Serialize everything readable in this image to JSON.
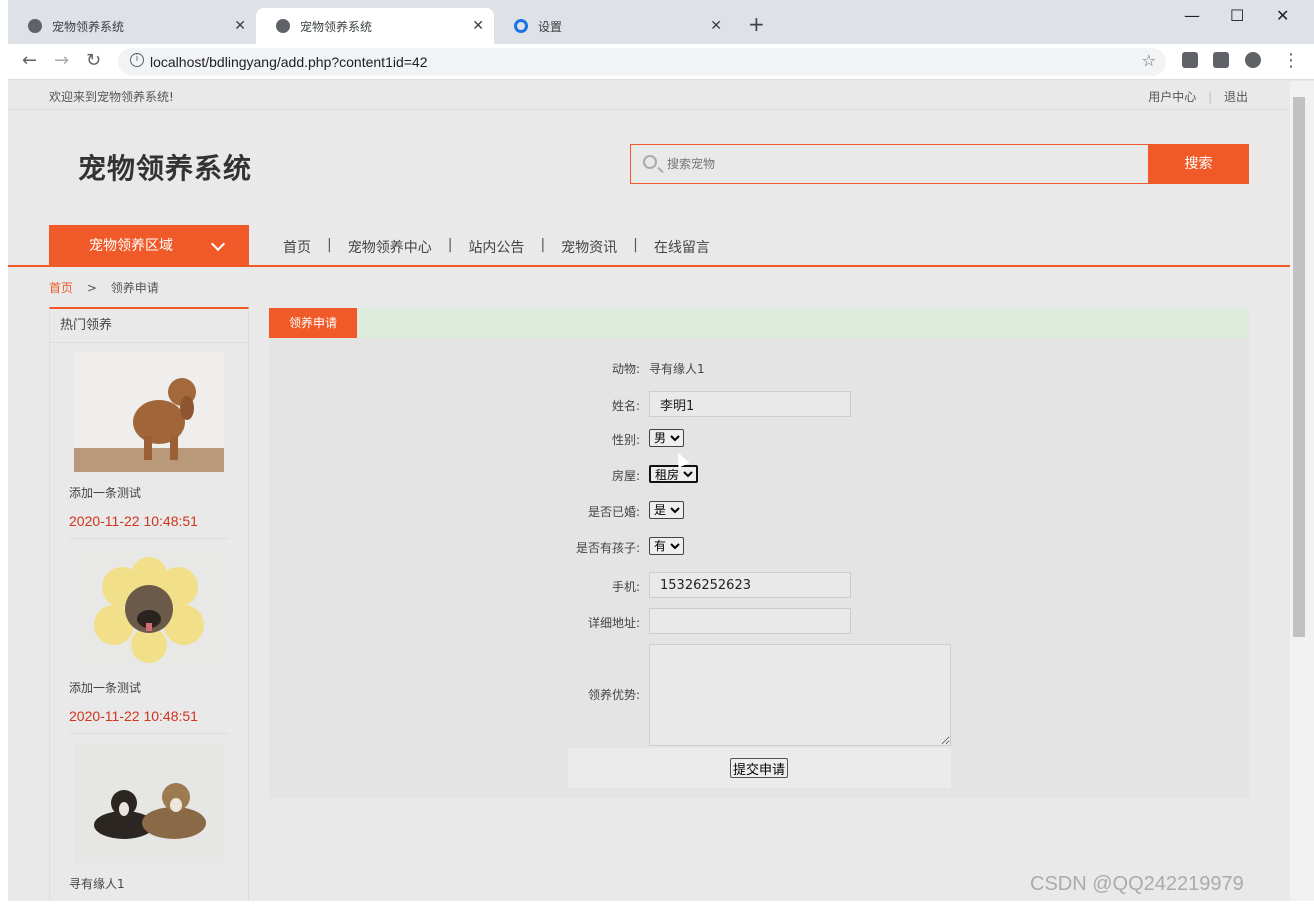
{
  "browser": {
    "tabs": [
      {
        "label": "宠物领养系统",
        "active": false
      },
      {
        "label": "宠物领养系统",
        "active": true
      },
      {
        "label": "设置",
        "active": false
      }
    ],
    "new_tab": "+",
    "url": "localhost/bdlingyang/add.php?content1id=42",
    "window_controls": {
      "minimize": "—",
      "maximize": "☐",
      "close": "✕"
    }
  },
  "site": {
    "welcome": "欢迎来到宠物领养系统!",
    "top_links": [
      "用户中心",
      "|",
      "退出"
    ],
    "logo": "宠物领养系统",
    "search": {
      "placeholder": "搜索宠物",
      "button": "搜索"
    },
    "category_button": "宠物领养区域",
    "nav": [
      "首页",
      "宠物领养中心",
      "站内公告",
      "宠物资讯",
      "在线留言"
    ],
    "nav_sep": "|",
    "breadcrumb": {
      "home": "首页",
      "sep": ">",
      "current": "领养申请"
    }
  },
  "sidebar": {
    "title": "热门领养",
    "items": [
      {
        "name": "添加一条测试",
        "date": "2020-11-22 10:48:51"
      },
      {
        "name": "添加一条测试",
        "date": "2020-11-22 10:48:51"
      },
      {
        "name": "寻有缘人1",
        "date": ""
      }
    ]
  },
  "form": {
    "tab": "领养申请",
    "animal_label": "动物:",
    "animal_value": "寻有缘人1",
    "name_label": "姓名:",
    "name_value": "李明1",
    "gender_label": "性别:",
    "gender_value": "男",
    "house_label": "房屋:",
    "house_value": "租房",
    "married_label": "是否已婚:",
    "married_value": "是",
    "children_label": "是否有孩子:",
    "children_value": "有",
    "phone_label": "手机:",
    "phone_value": "15326252623",
    "address_label": "详细地址:",
    "address_value": "",
    "advantage_label": "领养优势:",
    "advantage_value": "",
    "submit": "提交申请"
  },
  "watermark": "CSDN @QQ242219979",
  "colors": {
    "accent": "#f05a28",
    "date": "#d0341c"
  }
}
